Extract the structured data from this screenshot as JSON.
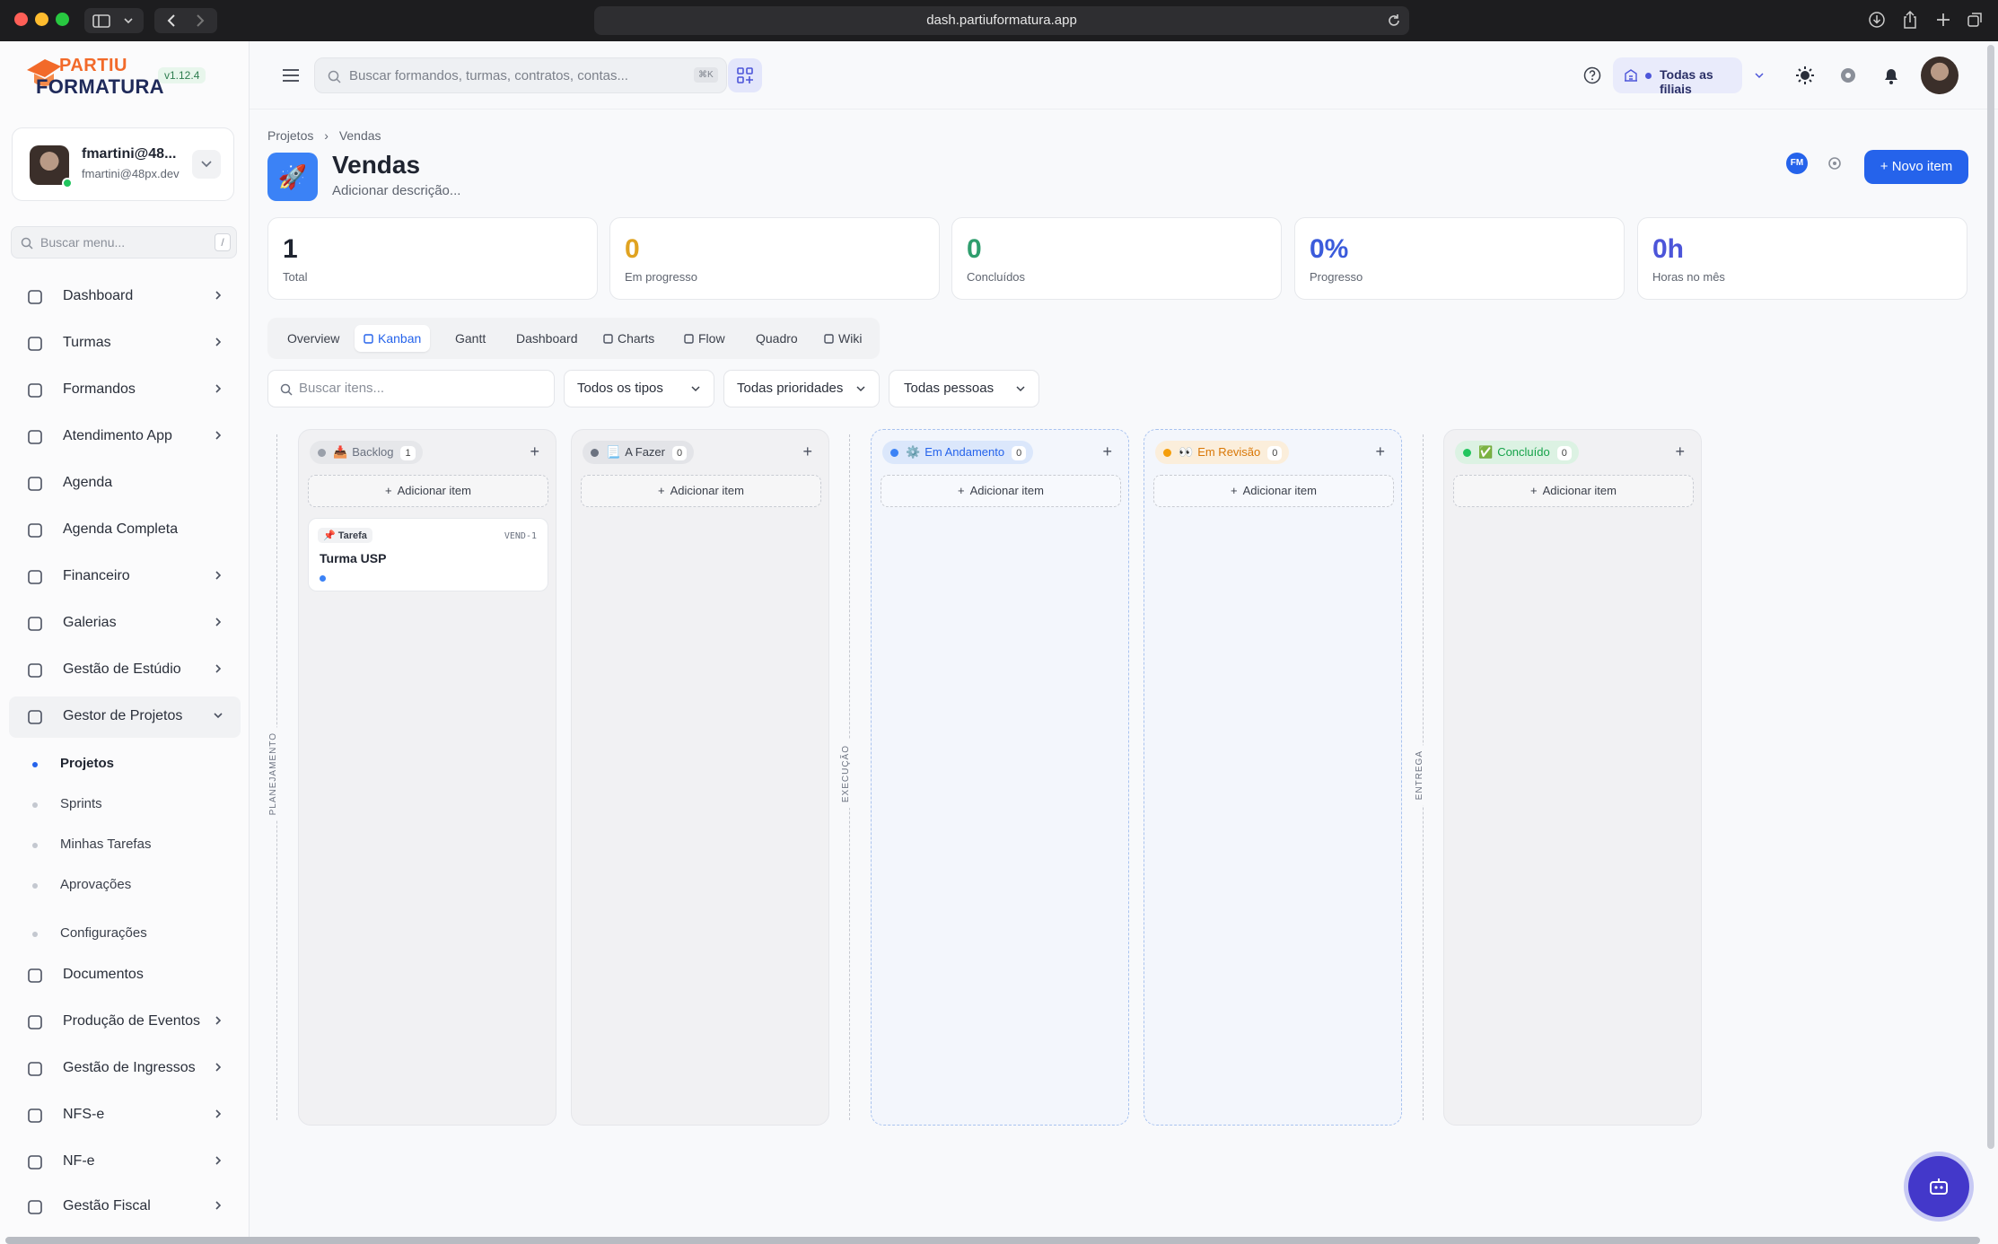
{
  "browser": {
    "url": "dash.partiuformatura.app"
  },
  "brand": {
    "line1": "PARTIU",
    "line2": "FORMATURA",
    "version": "v1.12.4"
  },
  "user": {
    "name": "fmartini@48...",
    "email": "fmartini@48px.dev"
  },
  "sidebar_search": {
    "placeholder": "Buscar menu...",
    "shortcut": "/"
  },
  "nav": [
    {
      "label": "Dashboard",
      "icon": "bar-chart-icon"
    },
    {
      "label": "Turmas",
      "icon": "graduation-cap-icon"
    },
    {
      "label": "Formandos",
      "icon": "users-icon"
    },
    {
      "label": "Atendimento App",
      "icon": "message-icon"
    },
    {
      "label": "Agenda",
      "icon": "calendar-icon"
    },
    {
      "label": "Agenda Completa",
      "icon": "calendar-icon"
    },
    {
      "label": "Financeiro",
      "icon": "dollar-icon"
    },
    {
      "label": "Galerias",
      "icon": "image-icon"
    },
    {
      "label": "Gestão de Estúdio",
      "icon": "camera-icon"
    },
    {
      "label": "Gestor de Projetos",
      "icon": "kanban-icon"
    },
    {
      "label": "Documentos",
      "icon": "document-icon"
    },
    {
      "label": "Produção de Eventos",
      "icon": "sparkle-icon"
    },
    {
      "label": "Gestão de Ingressos",
      "icon": "ticket-icon"
    },
    {
      "label": "NFS-e",
      "icon": "receipt-icon"
    },
    {
      "label": "NF-e",
      "icon": "receipt-icon"
    },
    {
      "label": "Gestão Fiscal",
      "icon": "calculator-icon"
    }
  ],
  "subnav": [
    "Projetos",
    "Sprints",
    "Minhas Tarefas",
    "Aprovações",
    "Configurações"
  ],
  "topbar": {
    "search_placeholder": "Buscar formandos, turmas, contratos, contas...",
    "shortcut": "⌘K",
    "branch": "Todas as filiais"
  },
  "breadcrumb": {
    "root": "Projetos",
    "current": "Vendas"
  },
  "project": {
    "title": "Vendas",
    "description": "Adicionar descrição...",
    "emoji": "🚀",
    "member_initials": "FM",
    "new_item": "Novo item"
  },
  "stats": [
    {
      "value": "1",
      "label": "Total",
      "color": "#1f2430"
    },
    {
      "value": "0",
      "label": "Em progresso",
      "color": "#e0a321"
    },
    {
      "value": "0",
      "label": "Concluídos",
      "color": "#2f9e6e"
    },
    {
      "value": "0%",
      "label": "Progresso",
      "color": "#3b5bdb"
    },
    {
      "value": "0h",
      "label": "Horas no mês",
      "color": "#4c55d9"
    }
  ],
  "tabs": [
    "Overview",
    "Kanban",
    "Gantt",
    "Dashboard",
    "Charts",
    "Flow",
    "Quadro",
    "Wiki"
  ],
  "filters": {
    "search_placeholder": "Buscar itens...",
    "types": "Todos os tipos",
    "priorities": "Todas prioridades",
    "people": "Todas pessoas"
  },
  "phases": [
    "PLANEJAMENTO",
    "EXECUÇÃO",
    "ENTREGA"
  ],
  "columns": [
    {
      "name": "Backlog",
      "emoji": "📥",
      "count": "1",
      "dot": "#9aa0aa",
      "text": "#6b7280",
      "pill": "#e6e7ea"
    },
    {
      "name": "A Fazer",
      "emoji": "📃",
      "count": "0",
      "dot": "#6b7280",
      "text": "#3a3f4a",
      "pill": "#e3e4e8"
    },
    {
      "name": "Em Andamento",
      "emoji": "⚙️",
      "count": "0",
      "dot": "#3b82f6",
      "text": "#2563eb",
      "pill": "#dbe7fb"
    },
    {
      "name": "Em Revisão",
      "emoji": "👀",
      "count": "0",
      "dot": "#f59e0b",
      "text": "#d97706",
      "pill": "#fbeedb"
    },
    {
      "name": "Concluído",
      "emoji": "✅",
      "count": "0",
      "dot": "#22c55e",
      "text": "#16a34a",
      "pill": "#dcf2e3"
    }
  ],
  "add_item": "Adicionar item",
  "card": {
    "type": "Tarefa",
    "type_emoji": "📌",
    "id": "VEND-1",
    "title": "Turma USP"
  }
}
